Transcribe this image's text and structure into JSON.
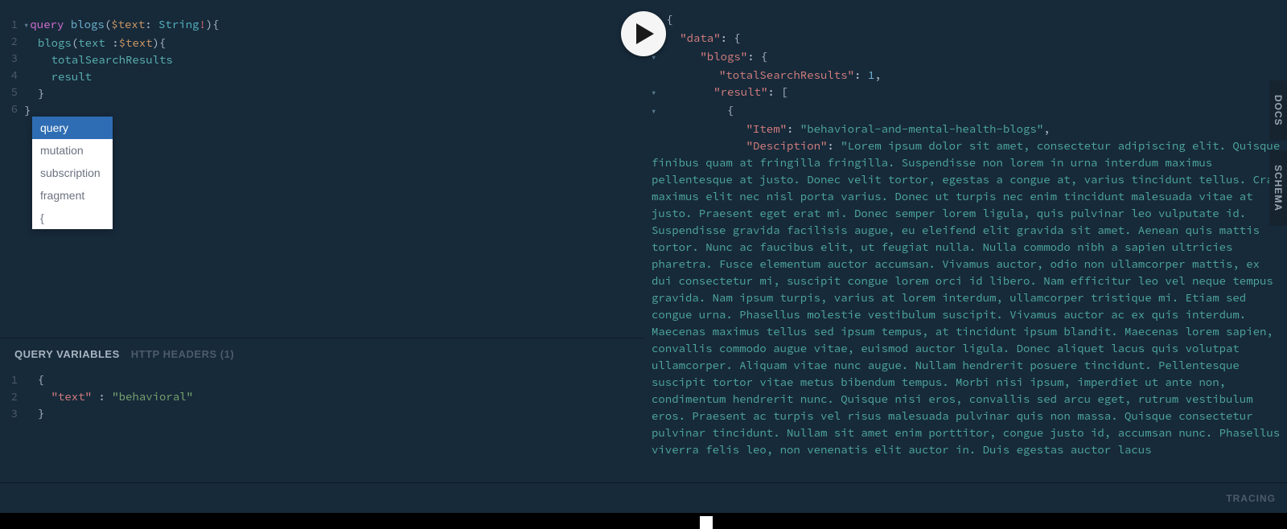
{
  "editor": {
    "lines": [
      "1",
      "2",
      "3",
      "4",
      "5",
      "6"
    ],
    "tokens": {
      "l1_query": "query",
      "l1_name": "blogs",
      "l1_var": "$text",
      "l1_type": "String",
      "l2_field": "blogs",
      "l2_arg": "text",
      "l2_var": "$text",
      "l3_field": "totalSearchResults",
      "l4_field": "result"
    }
  },
  "autocomplete": {
    "items": [
      "query",
      "mutation",
      "subscription",
      "fragment",
      "{"
    ],
    "selected_index": 0
  },
  "variables": {
    "tab_vars": "QUERY VARIABLES",
    "tab_headers": "HTTP HEADERS (1)",
    "lines": [
      "1",
      "2",
      "3"
    ],
    "key": "\"text\"",
    "value": "\"behavioral\""
  },
  "response": {
    "data_key": "\"data\"",
    "blogs_key": "\"blogs\"",
    "total_key": "\"totalSearchResults\"",
    "total_val": 1,
    "result_key": "\"result\"",
    "item_key": "\"Item\"",
    "item_val": "\"behavioral-and-mental-health-blogs\"",
    "desc_key": "\"Desciption\"",
    "desc_val": "\"Lorem ipsum dolor sit amet, consectetur adipiscing elit. Quisque finibus quam at fringilla fringilla. Suspendisse non lorem in urna interdum maximus pellentesque at justo. Donec velit tortor, egestas a congue at, varius tincidunt tellus. Cras maximus elit nec nisl porta varius. Donec ut turpis nec enim tincidunt malesuada vitae at justo. Praesent eget erat mi. Donec semper lorem ligula, quis pulvinar leo vulputate id. Suspendisse gravida facilisis augue, eu eleifend elit gravida sit amet. Aenean quis mattis tortor. Nunc ac faucibus elit, ut feugiat nulla. Nulla commodo nibh a sapien ultricies pharetra. Fusce elementum auctor accumsan. Vivamus auctor, odio non ullamcorper mattis, ex dui consectetur mi, suscipit congue lorem orci id libero. Nam efficitur leo vel neque tempus gravida. Nam ipsum turpis, varius at lorem interdum, ullamcorper tristique mi. Etiam sed congue urna. Phasellus molestie vestibulum suscipit. Vivamus auctor ac ex quis interdum. Maecenas maximus tellus sed ipsum tempus, at tincidunt ipsum blandit. Maecenas lorem sapien, convallis commodo augue vitae, euismod auctor ligula. Donec aliquet lacus quis volutpat ullamcorper. Aliquam vitae nunc augue. Nullam hendrerit posuere tincidunt. Pellentesque suscipit tortor vitae metus bibendum tempus. Morbi nisi ipsum, imperdiet ut ante non, condimentum hendrerit nunc. Quisque nisi eros, convallis sed arcu eget, rutrum vestibulum eros. Praesent ac turpis vel risus malesuada pulvinar quis non massa. Quisque consectetur pulvinar tincidunt. Nullam sit amet enim porttitor, congue justo id, accumsan nunc. Phasellus viverra felis leo, non venenatis elit auctor in. Duis egestas auctor lacus"
  },
  "side": {
    "docs": "DOCS",
    "schema": "SCHEMA"
  },
  "bottom": {
    "tracing": "TRACING"
  }
}
